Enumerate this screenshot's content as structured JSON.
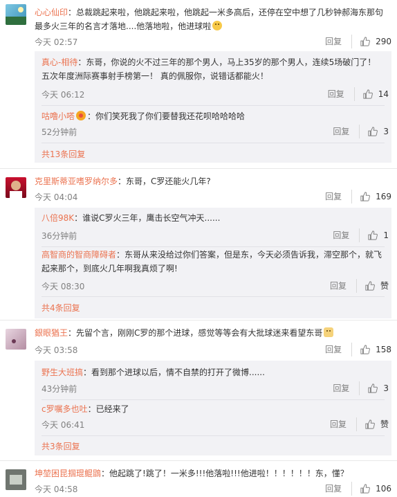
{
  "ui": {
    "reply_label": "回复",
    "like_icon": "thumbs-up-icon"
  },
  "comments": [
    {
      "user": "心心仙印",
      "text": "总裁跳起来啦，他跳起来啦，他跳起一米多高后，还停在空中想了几秒钟郝海东那句最多火三年的名言才落地....他落地啦，他进球啦",
      "time": "今天 02:57",
      "likes": "290",
      "replies": [
        {
          "user": "真心-相待",
          "text": "东哥，你说的火不过三年的那个男人，马上35岁的那个男人，连续5场破门了！五次年度洲际赛事射手榜第一！ 真的佩服你，说错话都能火！",
          "time": "今天 06:12",
          "likes": "14"
        },
        {
          "user": "咕噜小嗒",
          "text": "你们笑死我了你们要替我还花呗哈哈哈哈",
          "time": "52分钟前",
          "likes": "3"
        }
      ],
      "more": "共13条回复"
    },
    {
      "user": "克里斯蒂亚嗜罗纳尔多",
      "text": "东哥，C罗还能火几年?",
      "time": "今天 04:04",
      "likes": "169",
      "replies": [
        {
          "user": "八倍98K",
          "text": "谁说C罗火三年，鹰击长空气冲天......",
          "time": "36分钟前",
          "likes": "1"
        },
        {
          "user": "高智商的智商障碍者",
          "text": "东哥从来没给过你们答案，但是东，今天必须告诉我，滞空那个，就飞起来那个，到底火几年啊我真烦了啊!",
          "time": "今天 08:30",
          "likes": "赞"
        }
      ],
      "more": "共4条回复"
    },
    {
      "user": "銀眼猶王",
      "text": "先留个言，刚刚C罗的那个进球，感觉等等会有大批球迷来看望东哥",
      "time": "今天 03:58",
      "likes": "158",
      "replies": [
        {
          "user": "野生大班搞",
          "text": "看到那个进球以后，情不自禁的打开了微博......",
          "time": "43分钟前",
          "likes": "3"
        },
        {
          "user": "c罗嘱多也吐",
          "text": "已经来了",
          "time": "今天 06:41",
          "likes": "赞"
        }
      ],
      "more": "共3条回复"
    },
    {
      "user": "坤堃困昆掴琨鲲鵾",
      "text": "他起跳了!跳了！一米多!!!他落啦!!!他进啦！！！！！！东，懂？",
      "time": "今天 04:58",
      "likes": "106",
      "replies": []
    }
  ],
  "colors": {
    "accent": "#eb7350",
    "reply_bg": "#f2f2f5",
    "meta": "#808080"
  }
}
